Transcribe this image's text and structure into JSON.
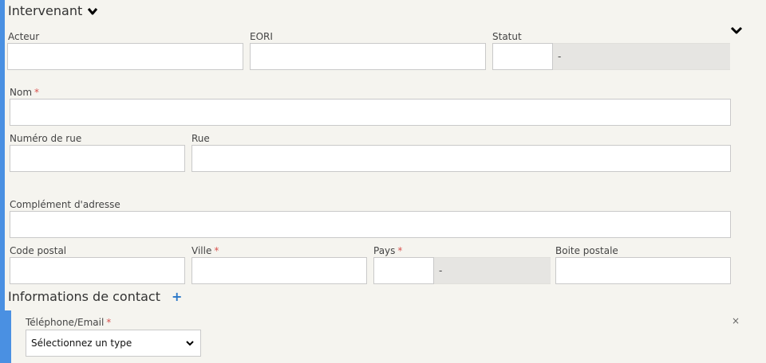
{
  "intervenant": {
    "title": "Intervenant"
  },
  "labels": {
    "acteur": "Acteur",
    "eori": "EORI",
    "statut": "Statut",
    "nom": "Nom",
    "numero_rue": "Numéro de rue",
    "rue": "Rue",
    "complement": "Complément d'adresse",
    "code_postal": "Code postal",
    "ville": "Ville",
    "pays": "Pays",
    "boite_postale": "Boite postale",
    "telephone_email": "Téléphone/Email"
  },
  "required_mark": "*",
  "values": {
    "statut_display": "-",
    "pays_display": "-"
  },
  "contact": {
    "title": "Informations de contact",
    "add_label": "+"
  },
  "contact_type": {
    "selected": "Sélectionnez un type"
  },
  "close_label": "×"
}
